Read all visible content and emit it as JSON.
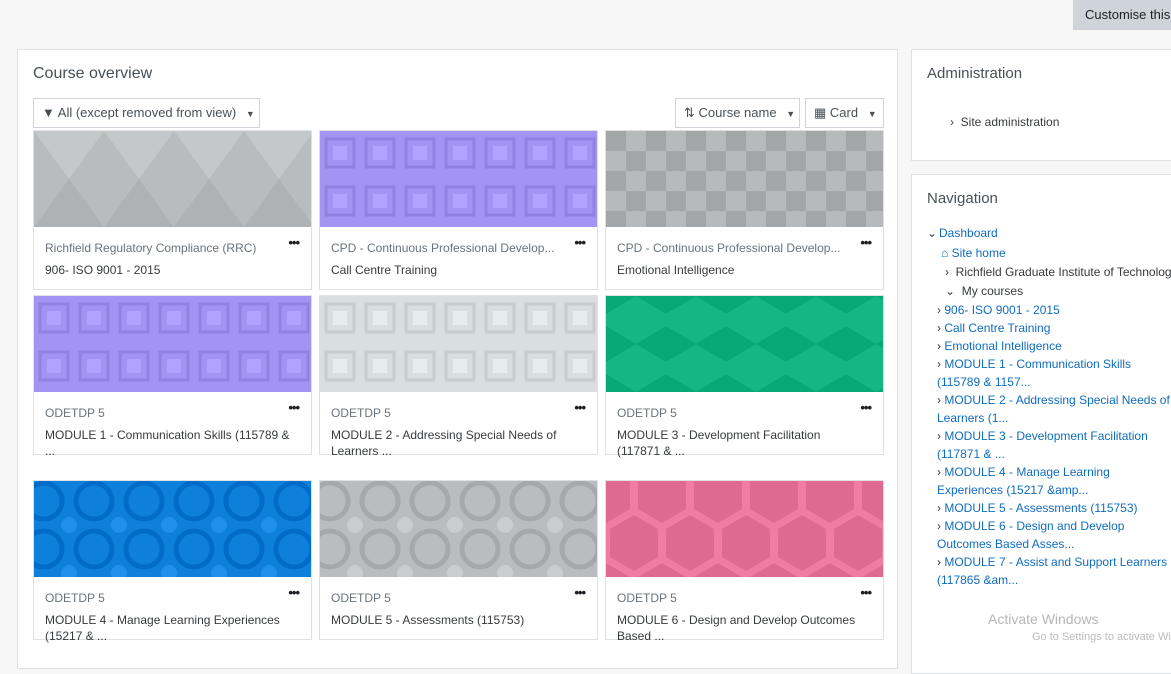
{
  "header": {
    "customise_label": "Customise this page"
  },
  "course_overview": {
    "title": "Course overview",
    "filter_label": "All (except removed from view)",
    "sort_label": "Course name",
    "view_label": "Card",
    "courses": [
      {
        "category": "Richfield Regulatory Compliance (RRC)",
        "name": "906- ISO 9001 - 2015",
        "pattern": "triangles",
        "color": "#b9bcbf"
      },
      {
        "category": "CPD - Continuous Professional Develop...",
        "name": "Call Centre Training",
        "pattern": "squares",
        "color": "#a394f3"
      },
      {
        "category": "CPD - Continuous Professional Develop...",
        "name": "Emotional Intelligence",
        "pattern": "mosaic",
        "color": "#b6babd"
      },
      {
        "category": "ODETDP 5",
        "name": "MODULE 1 - Communication Skills (115789 & ...",
        "pattern": "squares",
        "color": "#a394f3"
      },
      {
        "category": "ODETDP 5",
        "name": "MODULE 2 - Addressing Special Needs of Learners ...",
        "pattern": "squares",
        "color": "#d9dee0"
      },
      {
        "category": "ODETDP 5",
        "name": "MODULE 3 - Development Facilitation (117871 & ...",
        "pattern": "diamonds",
        "color": "#16b584"
      },
      {
        "category": "ODETDP 5",
        "name": "MODULE 4 - Manage Learning Experiences (15217 & ...",
        "pattern": "circles",
        "color": "#0e80dc"
      },
      {
        "category": "ODETDP 5",
        "name": "MODULE 5 - Assessments (115753)",
        "pattern": "circles",
        "color": "#babdbf"
      },
      {
        "category": "ODETDP 5",
        "name": "MODULE 6 - Design and Develop Outcomes Based ...",
        "pattern": "hexagons",
        "color": "#f27ba4"
      }
    ]
  },
  "administration": {
    "title": "Administration",
    "site_admin": "Site administration"
  },
  "navigation": {
    "title": "Navigation",
    "dashboard": "Dashboard",
    "site_home": "Site home",
    "institute": "Richfield Graduate Institute of Technology",
    "my_courses": "My courses",
    "items": [
      "906- ISO 9001 - 2015",
      "Call Centre Training",
      "Emotional Intelligence",
      "MODULE 1 - Communication Skills (115789 & 1157...",
      "MODULE 2 - Addressing Special Needs of Learners (1...",
      "MODULE 3 - Development Facilitation (117871 & ...",
      "MODULE 4 - Manage Learning Experiences (15217 &amp...",
      "MODULE 5 - Assessments (115753)",
      "MODULE 6 - Design and Develop Outcomes Based Asses...",
      "MODULE 7 - Assist and Support Learners (117865 &am..."
    ]
  },
  "watermark": {
    "line1": "Activate Windows",
    "line2": "Go to Settings to activate Windows."
  }
}
